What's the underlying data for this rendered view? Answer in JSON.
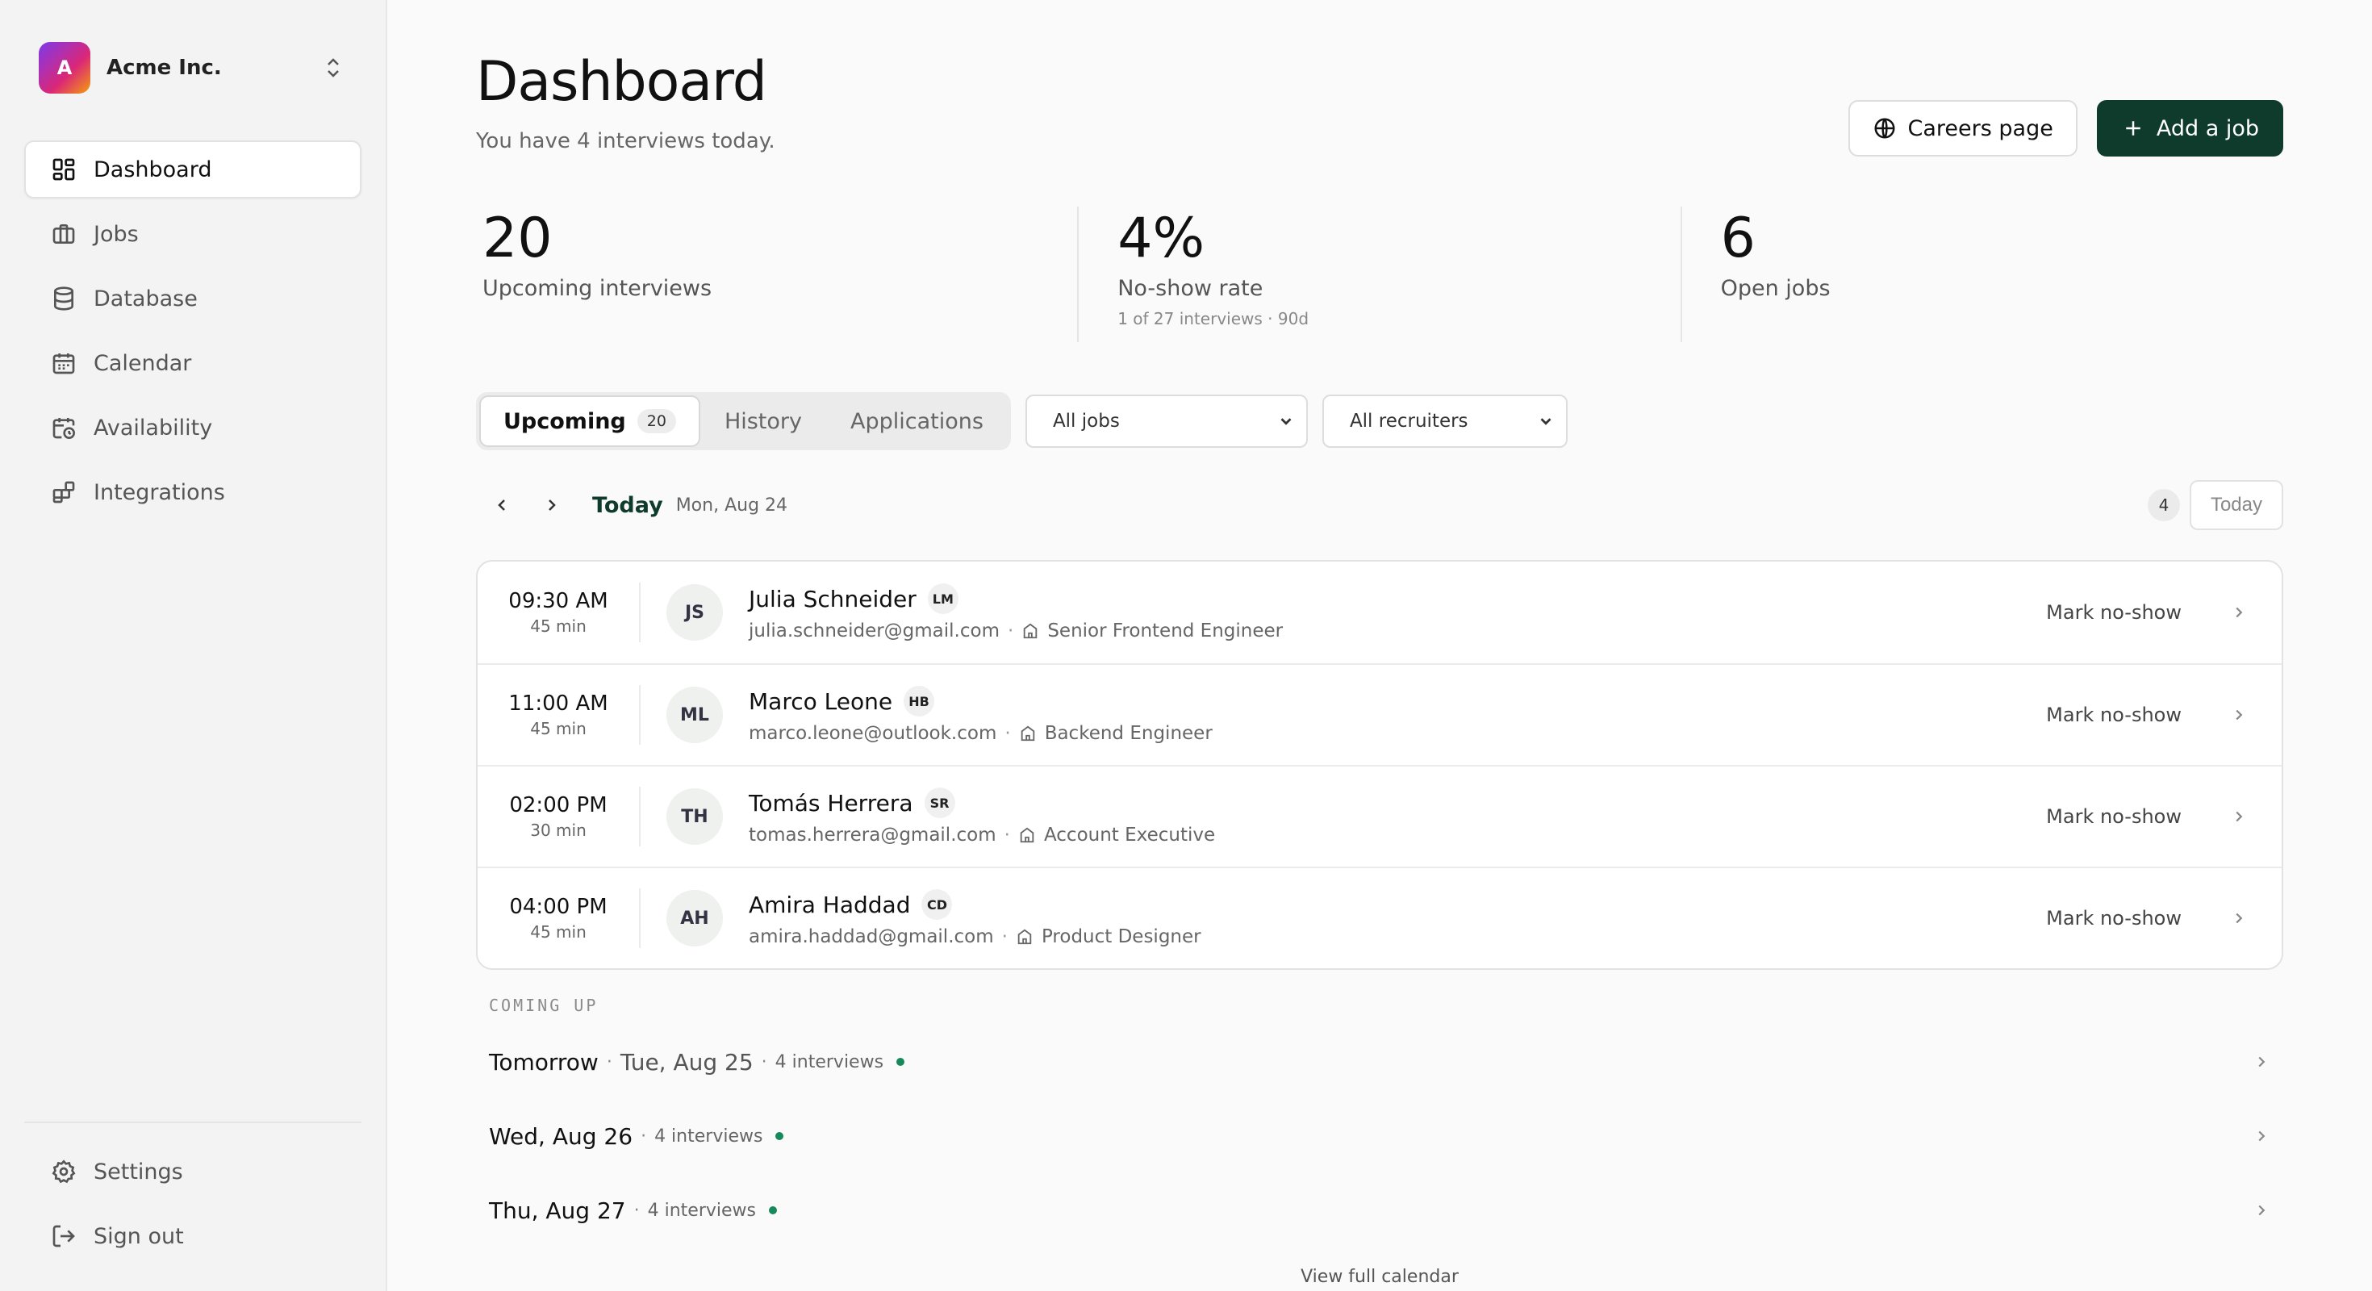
{
  "org": {
    "initial": "A",
    "name": "Acme Inc."
  },
  "nav": {
    "items": [
      {
        "label": "Dashboard",
        "icon": "dashboard-icon"
      },
      {
        "label": "Jobs",
        "icon": "briefcase-icon"
      },
      {
        "label": "Database",
        "icon": "database-icon"
      },
      {
        "label": "Calendar",
        "icon": "calendar-icon"
      },
      {
        "label": "Availability",
        "icon": "calendar-clock-icon"
      },
      {
        "label": "Integrations",
        "icon": "blocks-icon"
      }
    ],
    "bottom": [
      {
        "label": "Settings",
        "icon": "gear-icon"
      },
      {
        "label": "Sign out",
        "icon": "sign-out-icon"
      }
    ]
  },
  "header": {
    "title": "Dashboard",
    "subtitle": "You have 4 interviews today.",
    "careers_label": "Careers page",
    "add_job_label": "Add a job"
  },
  "stats": [
    {
      "value": "20",
      "label": "Upcoming interviews",
      "note": ""
    },
    {
      "value": "4%",
      "label": "No-show rate",
      "note": "1 of 27 interviews · 90d"
    },
    {
      "value": "6",
      "label": "Open jobs",
      "note": ""
    }
  ],
  "tabs": [
    {
      "label": "Upcoming",
      "count": "20"
    },
    {
      "label": "History"
    },
    {
      "label": "Applications"
    }
  ],
  "filters": {
    "jobs": "All jobs",
    "recruiters": "All recruiters"
  },
  "day": {
    "label": "Today",
    "date": "Mon, Aug 24",
    "count": "4",
    "today_button": "Today"
  },
  "interviews": [
    {
      "time": "09:30 AM",
      "duration": "45 min",
      "initials": "JS",
      "name": "Julia Schneider",
      "recruiter": "LM",
      "email": "julia.schneider@gmail.com",
      "job": "Senior Frontend Engineer",
      "action": "Mark no-show"
    },
    {
      "time": "11:00 AM",
      "duration": "45 min",
      "initials": "ML",
      "name": "Marco Leone",
      "recruiter": "HB",
      "email": "marco.leone@outlook.com",
      "job": "Backend Engineer",
      "action": "Mark no-show"
    },
    {
      "time": "02:00 PM",
      "duration": "30 min",
      "initials": "TH",
      "name": "Tomás Herrera",
      "recruiter": "SR",
      "email": "tomas.herrera@gmail.com",
      "job": "Account Executive",
      "action": "Mark no-show"
    },
    {
      "time": "04:00 PM",
      "duration": "45 min",
      "initials": "AH",
      "name": "Amira Haddad",
      "recruiter": "CD",
      "email": "amira.haddad@gmail.com",
      "job": "Product Designer",
      "action": "Mark no-show"
    }
  ],
  "coming_up": {
    "title": "COMING UP",
    "days": [
      {
        "day": "Tomorrow",
        "date": "Tue, Aug 25",
        "count": "4 interviews"
      },
      {
        "day": "Wed, Aug 26",
        "date": "",
        "count": "4 interviews"
      },
      {
        "day": "Thu, Aug 27",
        "date": "",
        "count": "4 interviews"
      }
    ]
  },
  "view_calendar": "View full calendar",
  "colors": {
    "primary": "#0f3b2c",
    "accent_dot": "#168a5a"
  }
}
